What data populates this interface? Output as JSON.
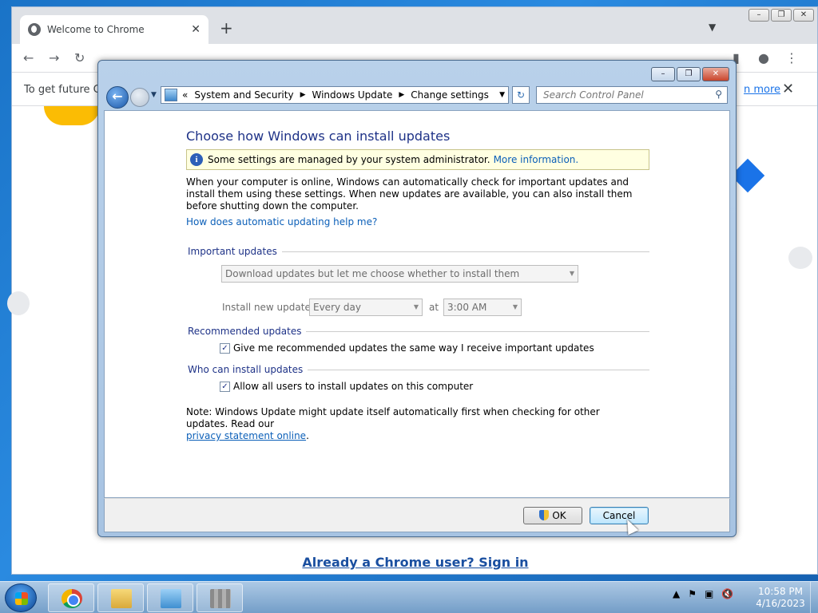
{
  "chrome": {
    "tab_title": "Welcome to Chrome",
    "tab_close": "✕",
    "new_tab": "+",
    "infobar_text": "To get future Go",
    "infobar_learn_more": "n more",
    "infobar_close": "✕",
    "signin_link": "Already a Chrome user? Sign in"
  },
  "control_panel": {
    "breadcrumbs": [
      "System and Security",
      "Windows Update",
      "Change settings"
    ],
    "breadcrumb_prefix": "«",
    "search_placeholder": "Search Control Panel",
    "heading": "Choose how Windows can install updates",
    "admin_banner_text": "Some settings are managed by your system administrator.",
    "admin_banner_link": "More information.",
    "intro_text": "When your computer is online, Windows can automatically check for important updates and install them using these settings. When new updates are available, you can also install them before shutting down the computer.",
    "help_link": "How does automatic updating help me?",
    "important_updates": {
      "header": "Important updates",
      "selected_option": "Download updates but let me choose whether to install them",
      "install_label": "Install new updates:",
      "frequency": "Every day",
      "at_label": "at",
      "time": "3:00 AM"
    },
    "recommended_updates": {
      "header": "Recommended updates",
      "checkbox_label": "Give me recommended updates the same way I receive important updates",
      "checked": true
    },
    "who_can_install": {
      "header": "Who can install updates",
      "checkbox_label": "Allow all users to install updates on this computer",
      "checked": true
    },
    "note_text": "Note: Windows Update might update itself automatically first when checking for other updates.  Read our",
    "privacy_link": "privacy statement online",
    "note_end": ".",
    "ok_label": "OK",
    "cancel_label": "Cancel"
  },
  "taskbar": {
    "time": "10:58 PM",
    "date": "4/16/2023"
  },
  "colors": {
    "heading": "#1e3287",
    "link": "#0b5fb8",
    "banner_bg": "#ffffe1"
  }
}
